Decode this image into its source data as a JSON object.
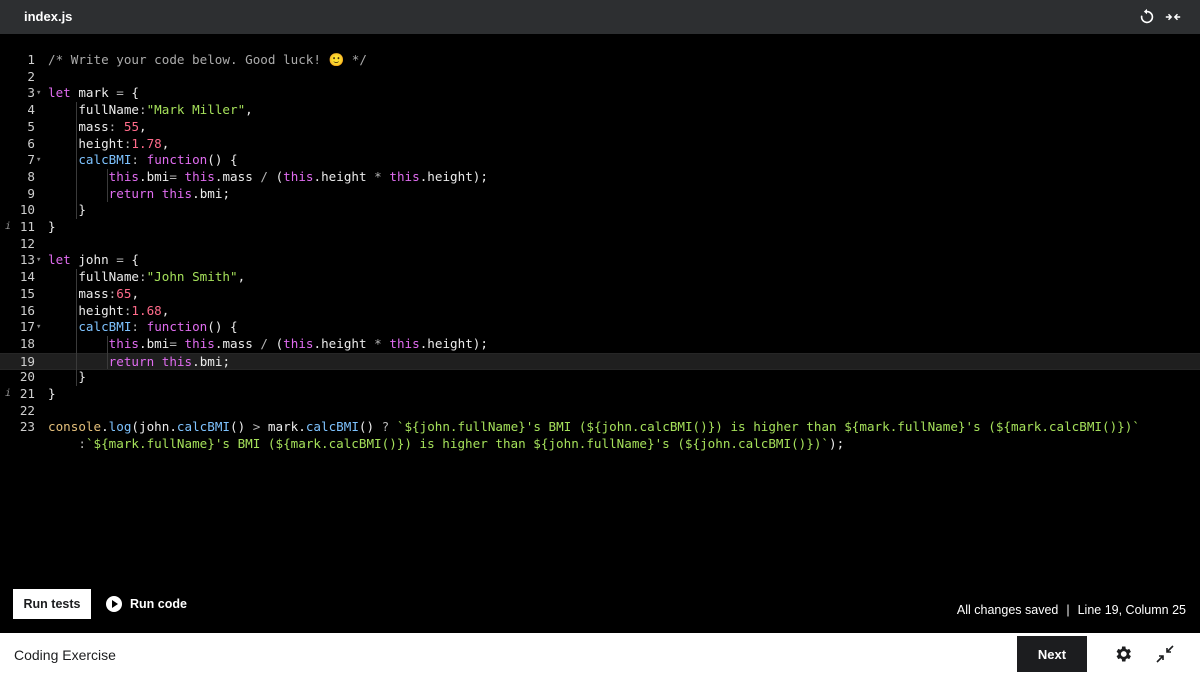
{
  "tab": {
    "title": "index.js"
  },
  "toolbar": {
    "reset_icon": "reset-icon",
    "expand_icon": "expand-icon"
  },
  "editor": {
    "lines": [
      {
        "n": "1",
        "t": "/* Write your code below. Good luck! 🙂 */"
      },
      {
        "n": "2",
        "t": ""
      },
      {
        "n": "3",
        "t": "let mark = {"
      },
      {
        "n": "4",
        "t": "    fullName:\"Mark Miller\","
      },
      {
        "n": "5",
        "t": "    mass: 55,"
      },
      {
        "n": "6",
        "t": "    height:1.78,"
      },
      {
        "n": "7",
        "t": "    calcBMI: function() {"
      },
      {
        "n": "8",
        "t": "        this.bmi= this.mass / (this.height * this.height);"
      },
      {
        "n": "9",
        "t": "        return this.bmi;"
      },
      {
        "n": "10",
        "t": "    }"
      },
      {
        "n": "11",
        "t": "}"
      },
      {
        "n": "12",
        "t": ""
      },
      {
        "n": "13",
        "t": "let john = {"
      },
      {
        "n": "14",
        "t": "    fullName:\"John Smith\","
      },
      {
        "n": "15",
        "t": "    mass:65,"
      },
      {
        "n": "16",
        "t": "    height:1.68,"
      },
      {
        "n": "17",
        "t": "    calcBMI: function() {"
      },
      {
        "n": "18",
        "t": "        this.bmi= this.mass / (this.height * this.height);"
      },
      {
        "n": "19",
        "t": "        return this.bmi;"
      },
      {
        "n": "20",
        "t": "    }"
      },
      {
        "n": "21",
        "t": "}"
      },
      {
        "n": "22",
        "t": ""
      },
      {
        "n": "23",
        "t": "console.log(john.calcBMI() > mark.calcBMI() ? `${john.fullName}'s BMI (${john.calcBMI()}) is higher than ${mark.fullName}'s (${mark.calcBMI()})`"
      },
      {
        "n": "",
        "t": "    :`${mark.fullName}'s BMI (${mark.calcBMI()}) is higher than ${john.fullName}'s (${john.calcBMI()})`);"
      }
    ],
    "fold_lines": [
      3,
      7,
      13,
      17
    ],
    "info_lines": [
      11,
      21
    ],
    "current_line": 19
  },
  "actions": {
    "run_tests": "Run tests",
    "run_code": "Run code"
  },
  "status": {
    "saved": "All changes saved",
    "separator": "|",
    "position": "Line 19, Column 25"
  },
  "footer": {
    "label": "Coding Exercise",
    "next": "Next",
    "settings_icon": "gear-icon",
    "minimize_icon": "minimize-icon"
  }
}
